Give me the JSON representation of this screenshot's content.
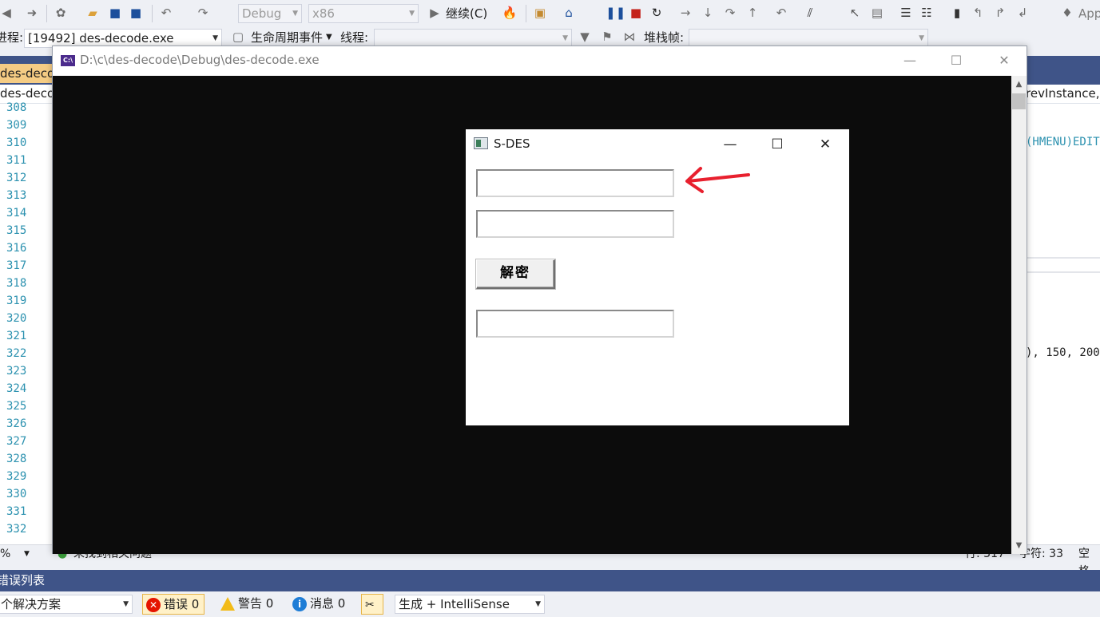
{
  "ide": {
    "toolbar": {
      "config_combo": "Debug",
      "platform_combo": "x86",
      "continue_label": "继续(C)",
      "app_label": "App",
      "process_label": "进程:",
      "process_value": "[19492] des-decode.exe",
      "lifecycle_label": "生命周期事件",
      "thread_label": "线程:",
      "stackframe_label": "堆栈帧:"
    },
    "doc_tab": "des-decode",
    "nav": {
      "left": "des-deco",
      "right_text": "revInstance, ",
      "right_mark": "h"
    },
    "line_numbers": [
      "308",
      "309",
      "310",
      "311",
      "312",
      "313",
      "314",
      "315",
      "316",
      "317",
      "318",
      "319",
      "320",
      "321",
      "322",
      "323",
      "324",
      "325",
      "326",
      "327",
      "328",
      "329",
      "330",
      "331",
      "332"
    ],
    "code_right": {
      "line310": "(HMENU)EDIT",
      "line322": "), 150, 200"
    },
    "status": {
      "zoom": "%",
      "issues": "未找到相关问题",
      "line": "行: 317",
      "char": "字符: 33",
      "space": "空格"
    },
    "panel_header": "错误列表",
    "errors": {
      "scope": "个解决方案",
      "errors_label": "错误 0",
      "warnings_label": "警告 0",
      "messages_label": "消息 0",
      "build_filter": "生成 + IntelliSense"
    }
  },
  "console": {
    "title": "D:\\c\\des-decode\\Debug\\des-decode.exe",
    "icon_text": "C:\\"
  },
  "app": {
    "title": "S-DES",
    "input1": "",
    "input2": "",
    "decrypt_button": "解密",
    "output": ""
  },
  "colors": {
    "ide_tab_active": "#f5cc84",
    "ide_panel": "#3f5488",
    "console_bg": "#0c0c0c",
    "annotation_arrow": "#e8202e",
    "line_number": "#2b91af"
  }
}
